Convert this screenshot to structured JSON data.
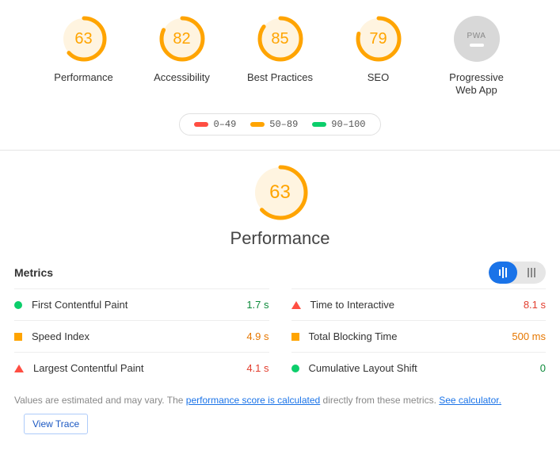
{
  "colors": {
    "pass": "#0cce6b",
    "average": "#ffa400",
    "fail": "#ff4e42",
    "link": "#1a73e8"
  },
  "scores": [
    {
      "label": "Performance",
      "value": 63
    },
    {
      "label": "Accessibility",
      "value": 82
    },
    {
      "label": "Best Practices",
      "value": 85
    },
    {
      "label": "SEO",
      "value": 79
    }
  ],
  "pwa": {
    "label": "Progressive Web App",
    "badge": "PWA"
  },
  "legend": [
    {
      "range": "0–49",
      "color": "#ff4e42"
    },
    {
      "range": "50–89",
      "color": "#ffa400"
    },
    {
      "range": "90–100",
      "color": "#0cce6b"
    }
  ],
  "section": {
    "title": "Performance",
    "value": 63
  },
  "metrics": {
    "heading": "Metrics",
    "items": [
      {
        "name": "First Contentful Paint",
        "value": "1.7 s",
        "status": "pass"
      },
      {
        "name": "Time to Interactive",
        "value": "8.1 s",
        "status": "fail"
      },
      {
        "name": "Speed Index",
        "value": "4.9 s",
        "status": "average"
      },
      {
        "name": "Total Blocking Time",
        "value": "500 ms",
        "status": "average"
      },
      {
        "name": "Largest Contentful Paint",
        "value": "4.1 s",
        "status": "fail"
      },
      {
        "name": "Cumulative Layout Shift",
        "value": "0",
        "status": "pass"
      }
    ]
  },
  "footnote": {
    "pre": "Values are estimated and may vary. The ",
    "link1": "performance score is calculated",
    "mid": " directly from these metrics. ",
    "link2": "See calculator."
  },
  "trace_button": "View Trace"
}
